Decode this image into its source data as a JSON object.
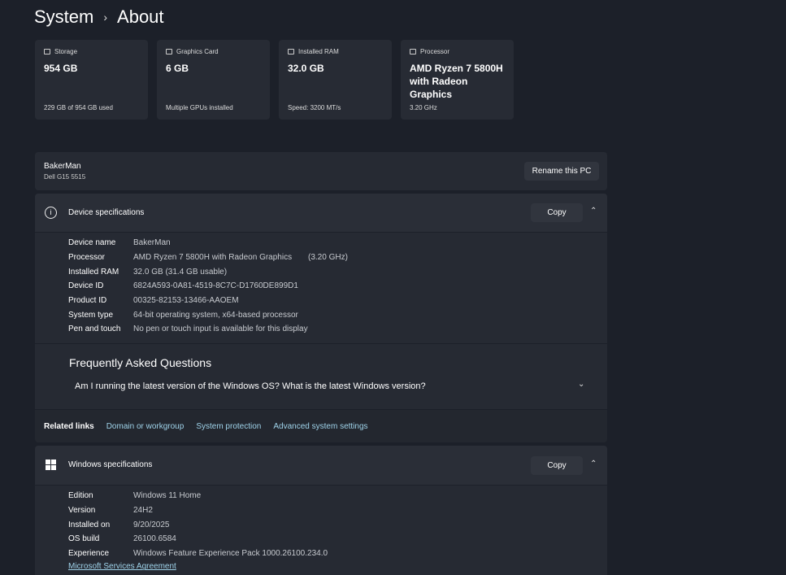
{
  "breadcrumb": {
    "parent": "System",
    "current": "About"
  },
  "cards": [
    {
      "label": "Storage",
      "icon": "storage-icon",
      "value": "954 GB",
      "sub": "229 GB of 954 GB used"
    },
    {
      "label": "Graphics Card",
      "icon": "graphics-card-icon",
      "value": "6 GB",
      "sub": "Multiple GPUs installed"
    },
    {
      "label": "Installed RAM",
      "icon": "ram-icon",
      "value": "32.0 GB",
      "sub": "Speed: 3200 MT/s"
    },
    {
      "label": "Processor",
      "icon": "processor-icon",
      "value": "AMD Ryzen 7 5800H with Radeon Graphics",
      "sub": "3.20 GHz"
    }
  ],
  "pc": {
    "name": "BakerMan",
    "model": "Dell G15 5515",
    "rename_label": "Rename this PC"
  },
  "device_specs": {
    "title": "Device specifications",
    "copy_label": "Copy",
    "rows": [
      {
        "k": "Device name",
        "v": "BakerMan"
      },
      {
        "k": "Processor",
        "v": "AMD Ryzen 7 5800H with Radeon Graphics",
        "extra": "(3.20 GHz)"
      },
      {
        "k": "Installed RAM",
        "v": "32.0 GB (31.4 GB usable)"
      },
      {
        "k": "Device ID",
        "v": "6824A593-0A81-4519-8C7C-D1760DE899D1"
      },
      {
        "k": "Product ID",
        "v": "00325-82153-13466-AAOEM"
      },
      {
        "k": "System type",
        "v": "64-bit operating system, x64-based processor"
      },
      {
        "k": "Pen and touch",
        "v": "No pen or touch input is available for this display"
      }
    ]
  },
  "faq": {
    "title": "Frequently Asked Questions",
    "question": "Am I running the latest version of the Windows OS? What is the latest Windows version?"
  },
  "related": {
    "label": "Related links",
    "links": [
      "Domain or workgroup",
      "System protection",
      "Advanced system settings"
    ]
  },
  "windows_specs": {
    "title": "Windows specifications",
    "copy_label": "Copy",
    "rows": [
      {
        "k": "Edition",
        "v": "Windows 11 Home"
      },
      {
        "k": "Version",
        "v": "24H2"
      },
      {
        "k": "Installed on",
        "v": "9/20/2025"
      },
      {
        "k": "OS build",
        "v": "26100.6584"
      },
      {
        "k": "Experience",
        "v": "Windows Feature Experience Pack 1000.26100.234.0"
      }
    ],
    "link": "Microsoft Services Agreement"
  }
}
